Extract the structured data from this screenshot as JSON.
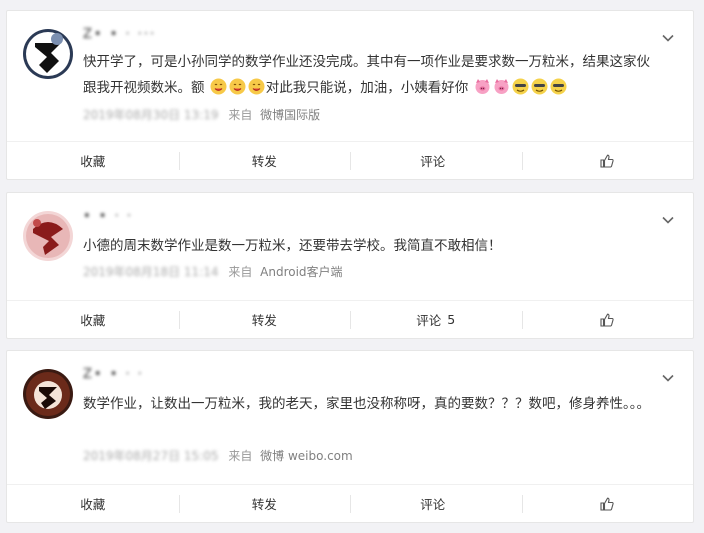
{
  "comments": [
    {
      "username": "Z• • · ···",
      "content_parts": [
        "快开学了，可是小孙同学的数学作业还没完成。其中有一项作业是要求数一万粒米，结果这家伙跟我开视频数米。额",
        "对此我只能说，加油，小姨看好你"
      ],
      "emojis_a": [
        "yummy-face-icon",
        "yummy-face-icon",
        "yummy-face-icon"
      ],
      "emojis_b": [
        "pig-face-icon",
        "pig-face-icon",
        "doge-face-icon",
        "doge-face-icon",
        "doge-face-icon"
      ],
      "time": "2019年08月30日 13:19",
      "source_prefix": "来自",
      "source": "微博国际版",
      "actions": {
        "collect": "收藏",
        "repost": "转发",
        "comment": "评论",
        "comment_count": ""
      }
    },
    {
      "username": "• • · ·",
      "content_parts": [
        "小德的周末数学作业是数一万粒米，还要带去学校。我简直不敢相信！"
      ],
      "time": "2019年08月18日 11:14",
      "source_prefix": "来自",
      "source": "Android客户端",
      "actions": {
        "collect": "收藏",
        "repost": "转发",
        "comment": "评论",
        "comment_count": "5"
      }
    },
    {
      "username": "Z• • · ·",
      "content_parts": [
        "数学作业，让数出一万粒米，我的老天，家里也没称称呀，真的要数？？？数吧，修身养性。。。"
      ],
      "time": "2019年08月27日 15:05",
      "source_prefix": "来自",
      "source": "微博 weibo.com",
      "actions": {
        "collect": "收藏",
        "repost": "转发",
        "comment": "评论",
        "comment_count": ""
      }
    }
  ],
  "colors": {
    "background": "#f2f2f5",
    "card": "#ffffff",
    "text": "#333333",
    "meta": "#999999",
    "divider": "#e6e6e6"
  }
}
